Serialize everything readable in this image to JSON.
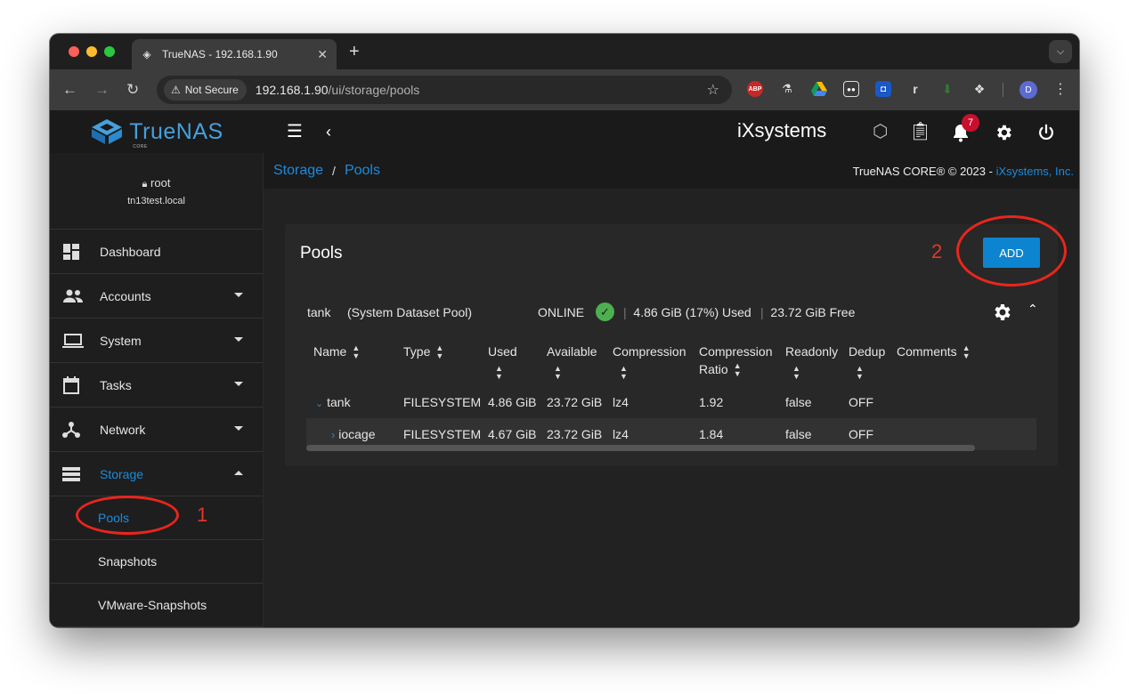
{
  "browser": {
    "tab_title": "TrueNAS - 192.168.1.90",
    "not_secure": "Not Secure",
    "url_host": "192.168.1.90",
    "url_path": "/ui/storage/pools",
    "avatar_letter": "D",
    "ext_abp": "ABP"
  },
  "app": {
    "logo_text": "TrueNAS",
    "logo_sub": "CORE",
    "vendor_logo": "iXsystems",
    "notification_count": "7"
  },
  "sidebar": {
    "username": "root",
    "hostname": "tn13test.local",
    "items": [
      {
        "label": "Dashboard",
        "icon": "dashboard-icon"
      },
      {
        "label": "Accounts",
        "icon": "people-icon"
      },
      {
        "label": "System",
        "icon": "laptop-icon"
      },
      {
        "label": "Tasks",
        "icon": "calendar-icon"
      },
      {
        "label": "Network",
        "icon": "network-icon"
      },
      {
        "label": "Storage",
        "icon": "storage-icon"
      }
    ],
    "sub_items": [
      {
        "label": "Pools"
      },
      {
        "label": "Snapshots"
      },
      {
        "label": "VMware-Snapshots"
      }
    ]
  },
  "breadcrumb": {
    "parent": "Storage",
    "separator": "/",
    "current": "Pools"
  },
  "copyright": {
    "text": "TrueNAS CORE® © 2023 - ",
    "brand": "iXsystems, Inc."
  },
  "pools": {
    "title": "Pools",
    "add_label": "ADD",
    "pool": {
      "name": "tank",
      "description": "(System Dataset Pool)",
      "status": "ONLINE",
      "used": "4.86 GiB (17%) Used",
      "free": "23.72 GiB Free",
      "separator": "|"
    },
    "columns": [
      "Name",
      "Type",
      "Used",
      "Available",
      "Compression",
      "Compression",
      "Readonly",
      "Dedup",
      "Comments"
    ],
    "column_ratio_second_line": "Ratio",
    "rows": [
      {
        "name": "tank",
        "type": "FILESYSTEM",
        "used": "4.86 GiB",
        "available": "23.72 GiB",
        "compression": "lz4",
        "ratio": "1.92",
        "readonly": "false",
        "dedup": "OFF"
      },
      {
        "name": "iocage",
        "type": "FILESYSTEM",
        "used": "4.67 GiB",
        "available": "23.72 GiB",
        "compression": "lz4",
        "ratio": "1.84",
        "readonly": "false",
        "dedup": "OFF"
      }
    ]
  },
  "annotations": {
    "one": "1",
    "two": "2"
  },
  "colors": {
    "accent": "#1c8bdc",
    "add_button": "#0d84cf",
    "annotation_red": "#e8261d",
    "online_green": "#4caf50"
  }
}
